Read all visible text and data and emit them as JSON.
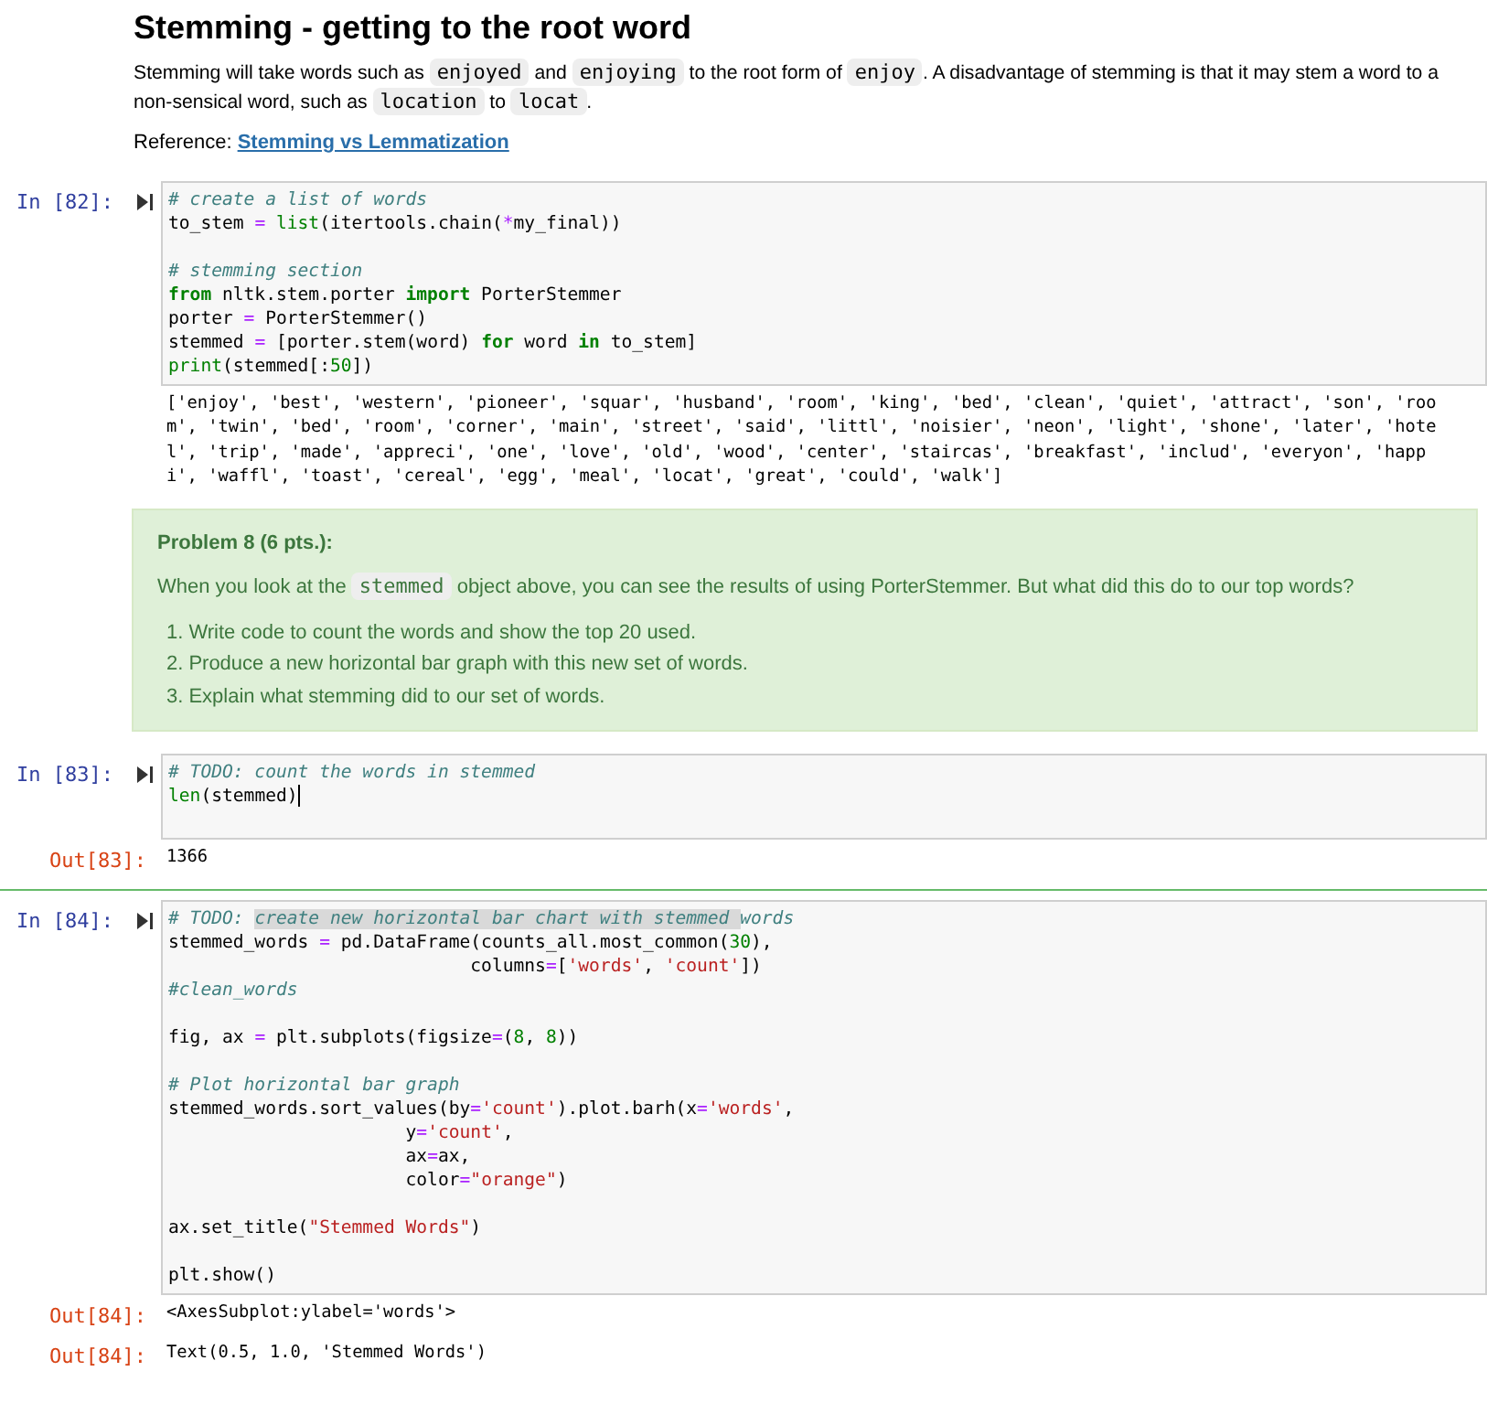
{
  "markdown": {
    "title": "Stemming - getting to the root word",
    "paragraph": [
      {
        "kind": "text",
        "t": "Stemming will take words such as "
      },
      {
        "kind": "code",
        "t": "enjoyed"
      },
      {
        "kind": "text",
        "t": " and "
      },
      {
        "kind": "code",
        "t": "enjoying"
      },
      {
        "kind": "text",
        "t": " to the root form of "
      },
      {
        "kind": "code",
        "t": "enjoy"
      },
      {
        "kind": "text",
        "t": ". A disadvantage of stemming is that it may stem a word to a non-sensical word, such as "
      },
      {
        "kind": "code",
        "t": "location"
      },
      {
        "kind": "text",
        "t": " to "
      },
      {
        "kind": "code",
        "t": "locat"
      },
      {
        "kind": "text",
        "t": "."
      }
    ],
    "reference_label": "Reference:",
    "reference_link": "Stemming vs Lemmatization"
  },
  "cells": [
    {
      "kind": "code",
      "prompt": "In [82]:",
      "lines": [
        {
          "kind": "code",
          "tokens": [
            {
              "kind": "comment",
              "t": "# create a list of words"
            }
          ]
        },
        {
          "kind": "code",
          "tokens": [
            {
              "kind": "plain",
              "t": "to_stem "
            },
            {
              "kind": "op",
              "t": "="
            },
            {
              "kind": "builtin",
              "t": " list"
            },
            {
              "kind": "plain",
              "t": "(itertools.chain("
            },
            {
              "kind": "op",
              "t": "*"
            },
            {
              "kind": "plain",
              "t": "my_final))"
            }
          ]
        },
        {
          "kind": "blank"
        },
        {
          "kind": "code",
          "tokens": [
            {
              "kind": "comment",
              "t": "# stemming section"
            }
          ]
        },
        {
          "kind": "code",
          "tokens": [
            {
              "kind": "keyword",
              "t": "from"
            },
            {
              "kind": "plain",
              "t": " nltk.stem.porter "
            },
            {
              "kind": "keyword",
              "t": "import"
            },
            {
              "kind": "plain",
              "t": " PorterStemmer"
            }
          ]
        },
        {
          "kind": "code",
          "tokens": [
            {
              "kind": "plain",
              "t": "porter "
            },
            {
              "kind": "op",
              "t": "="
            },
            {
              "kind": "plain",
              "t": " PorterStemmer()"
            }
          ]
        },
        {
          "kind": "code",
          "tokens": [
            {
              "kind": "plain",
              "t": "stemmed "
            },
            {
              "kind": "op",
              "t": "="
            },
            {
              "kind": "plain",
              "t": " [porter.stem(word) "
            },
            {
              "kind": "keyword",
              "t": "for"
            },
            {
              "kind": "plain",
              "t": " word "
            },
            {
              "kind": "keyword",
              "t": "in"
            },
            {
              "kind": "plain",
              "t": " to_stem]"
            }
          ]
        },
        {
          "kind": "code",
          "tokens": [
            {
              "kind": "builtin",
              "t": "print"
            },
            {
              "kind": "plain",
              "t": "(stemmed[:"
            },
            {
              "kind": "number",
              "t": "50"
            },
            {
              "kind": "plain",
              "t": "])"
            }
          ]
        }
      ],
      "outputs": [
        {
          "kind": "stream",
          "lines": [
            "['enjoy', 'best', 'western', 'pioneer', 'squar', 'husband', 'room', 'king', 'bed', 'clean', 'quiet', 'attract', 'son', 'roo",
            "m', 'twin', 'bed', 'room', 'corner', 'main', 'street', 'said', 'littl', 'noisier', 'neon', 'light', 'shone', 'later', 'hote",
            "l', 'trip', 'made', 'appreci', 'one', 'love', 'old', 'wood', 'center', 'staircas', 'breakfast', 'includ', 'everyon', 'happ",
            "i', 'waffl', 'toast', 'cereal', 'egg', 'meal', 'locat', 'great', 'could', 'walk']"
          ]
        }
      ]
    },
    {
      "kind": "problem",
      "title": "Problem 8 (6 pts.):",
      "paragraph": [
        {
          "kind": "text",
          "t": "When you look at the "
        },
        {
          "kind": "code",
          "t": "stemmed"
        },
        {
          "kind": "text",
          "t": " object above, you can see the results of using PorterStemmer. But what did this do to our top words?"
        }
      ],
      "items": [
        {
          "marker": "1.",
          "text": "Write code to count the words and show the top 20 used."
        },
        {
          "marker": "2.",
          "text": "Produce a new horizontal bar graph with this new set of words."
        },
        {
          "marker": "3.",
          "text": "Explain what stemming did to our set of words."
        }
      ]
    },
    {
      "kind": "code",
      "prompt": "In [83]:",
      "lines": [
        {
          "kind": "code",
          "tokens": [
            {
              "kind": "comment",
              "t": "# TODO: count the words in stemmed"
            }
          ]
        },
        {
          "kind": "code",
          "cursor": true,
          "tokens": [
            {
              "kind": "builtin",
              "t": "len"
            },
            {
              "kind": "plain",
              "t": "(stemmed)"
            }
          ]
        },
        {
          "kind": "blank"
        }
      ],
      "outputs": [
        {
          "kind": "result",
          "prompt": "Out[83]:",
          "lines": [
            "1366"
          ]
        }
      ]
    },
    {
      "kind": "code",
      "prompt": "In [84]:",
      "lines": [
        {
          "kind": "code",
          "tokens": [
            {
              "kind": "comment",
              "t": "# TODO: "
            },
            {
              "kind": "selected",
              "t": "create new horizontal bar chart with stemmed "
            },
            {
              "kind": "comment",
              "t": "words"
            }
          ]
        },
        {
          "kind": "code",
          "tokens": [
            {
              "kind": "plain",
              "t": "stemmed_words "
            },
            {
              "kind": "op",
              "t": "="
            },
            {
              "kind": "plain",
              "t": " pd.DataFrame(counts_all.most_common("
            },
            {
              "kind": "number",
              "t": "30"
            },
            {
              "kind": "plain",
              "t": "),"
            }
          ]
        },
        {
          "kind": "code",
          "tokens": [
            {
              "kind": "plain",
              "t": "                            columns"
            },
            {
              "kind": "op",
              "t": "="
            },
            {
              "kind": "plain",
              "t": "["
            },
            {
              "kind": "string",
              "t": "'words'"
            },
            {
              "kind": "plain",
              "t": ", "
            },
            {
              "kind": "string",
              "t": "'count'"
            },
            {
              "kind": "plain",
              "t": "])"
            }
          ]
        },
        {
          "kind": "code",
          "tokens": [
            {
              "kind": "comment",
              "t": "#clean_words"
            }
          ]
        },
        {
          "kind": "blank"
        },
        {
          "kind": "code",
          "tokens": [
            {
              "kind": "plain",
              "t": "fig, ax "
            },
            {
              "kind": "op",
              "t": "="
            },
            {
              "kind": "plain",
              "t": " plt.subplots(figsize"
            },
            {
              "kind": "op",
              "t": "="
            },
            {
              "kind": "plain",
              "t": "("
            },
            {
              "kind": "number",
              "t": "8"
            },
            {
              "kind": "plain",
              "t": ", "
            },
            {
              "kind": "number",
              "t": "8"
            },
            {
              "kind": "plain",
              "t": "))"
            }
          ]
        },
        {
          "kind": "blank"
        },
        {
          "kind": "code",
          "tokens": [
            {
              "kind": "comment",
              "t": "# Plot horizontal bar graph"
            }
          ]
        },
        {
          "kind": "code",
          "tokens": [
            {
              "kind": "plain",
              "t": "stemmed_words.sort_values(by"
            },
            {
              "kind": "op",
              "t": "="
            },
            {
              "kind": "string",
              "t": "'count'"
            },
            {
              "kind": "plain",
              "t": ").plot.barh(x"
            },
            {
              "kind": "op",
              "t": "="
            },
            {
              "kind": "string",
              "t": "'words'"
            },
            {
              "kind": "plain",
              "t": ","
            }
          ]
        },
        {
          "kind": "code",
          "tokens": [
            {
              "kind": "plain",
              "t": "                      y"
            },
            {
              "kind": "op",
              "t": "="
            },
            {
              "kind": "string",
              "t": "'count'"
            },
            {
              "kind": "plain",
              "t": ","
            }
          ]
        },
        {
          "kind": "code",
          "tokens": [
            {
              "kind": "plain",
              "t": "                      ax"
            },
            {
              "kind": "op",
              "t": "="
            },
            {
              "kind": "plain",
              "t": "ax,"
            }
          ]
        },
        {
          "kind": "code",
          "tokens": [
            {
              "kind": "plain",
              "t": "                      color"
            },
            {
              "kind": "op",
              "t": "="
            },
            {
              "kind": "string",
              "t": "\"orange\""
            },
            {
              "kind": "plain",
              "t": ")"
            }
          ]
        },
        {
          "kind": "blank"
        },
        {
          "kind": "code",
          "tokens": [
            {
              "kind": "plain",
              "t": "ax.set_title("
            },
            {
              "kind": "string",
              "t": "\"Stemmed Words\""
            },
            {
              "kind": "plain",
              "t": ")"
            }
          ]
        },
        {
          "kind": "blank"
        },
        {
          "kind": "code",
          "tokens": [
            {
              "kind": "plain",
              "t": "plt.show()"
            }
          ]
        }
      ],
      "outputs": [
        {
          "kind": "result",
          "prompt": "Out[84]:",
          "lines": [
            "<AxesSubplot:ylabel='words'>"
          ]
        },
        {
          "kind": "result",
          "prompt": "Out[84]:",
          "lines": [
            "Text(0.5, 1.0, 'Stemmed Words')"
          ]
        }
      ]
    }
  ]
}
